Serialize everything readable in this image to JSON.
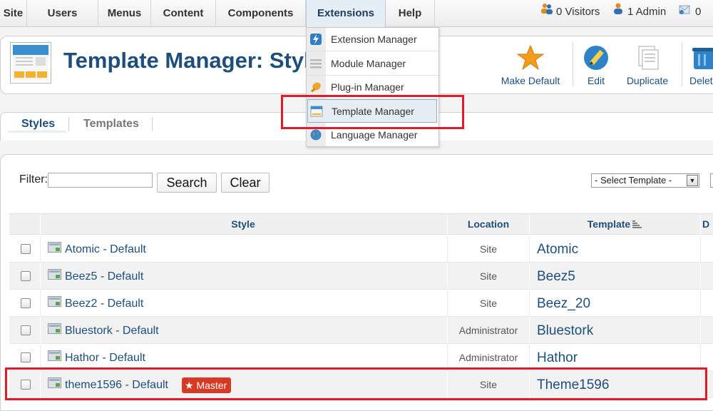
{
  "menubar": {
    "items": [
      {
        "label": "Site"
      },
      {
        "label": "Users"
      },
      {
        "label": "Menus"
      },
      {
        "label": "Content"
      },
      {
        "label": "Components"
      },
      {
        "label": "Extensions"
      },
      {
        "label": "Help"
      }
    ],
    "status": {
      "visitors": "0 Visitors",
      "admin": "1 Admin",
      "messages": "0"
    }
  },
  "extensions_menu": {
    "items": [
      {
        "label": "Extension Manager",
        "icon": "lightning-icon"
      },
      {
        "label": "Module Manager",
        "icon": "list-icon"
      },
      {
        "label": "Plug-in Manager",
        "icon": "plug-icon"
      },
      {
        "label": "Template Manager",
        "icon": "window-icon"
      },
      {
        "label": "Language Manager",
        "icon": "globe-icon"
      }
    ]
  },
  "header": {
    "title": "Template Manager: Styl"
  },
  "toolbar": {
    "make_default": "Make Default",
    "edit": "Edit",
    "duplicate": "Duplicate",
    "delete": "Delet"
  },
  "tabs": [
    {
      "label": "Styles"
    },
    {
      "label": "Templates"
    }
  ],
  "filter": {
    "label": "Filter:",
    "value": "",
    "search_label": "Search",
    "clear_label": "Clear",
    "template_select": "- Select Template -"
  },
  "table": {
    "columns": {
      "style": "Style",
      "location": "Location",
      "template": "Template",
      "extra": "D"
    },
    "rows": [
      {
        "style": "Atomic - Default",
        "location": "Site",
        "template": "Atomic"
      },
      {
        "style": "Beez5 - Default",
        "location": "Site",
        "template": "Beez5"
      },
      {
        "style": "Beez2 - Default",
        "location": "Site",
        "template": "Beez_20"
      },
      {
        "style": "Bluestork - Default",
        "location": "Administrator",
        "template": "Bluestork"
      },
      {
        "style": "Hathor - Default",
        "location": "Administrator",
        "template": "Hathor"
      },
      {
        "style": "theme1596 - Default",
        "location": "Site",
        "template": "Theme1596",
        "badge": "Master"
      }
    ]
  },
  "colors": {
    "accent": "#1d4e7c",
    "highlight": "#e21b2b",
    "badge": "#d63a24"
  }
}
